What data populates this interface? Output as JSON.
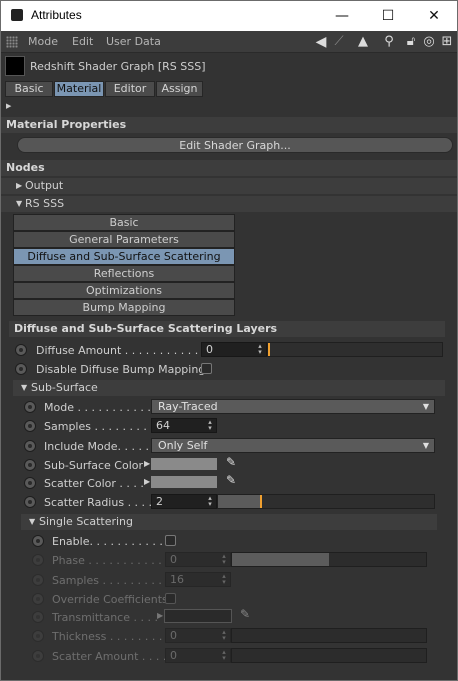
{
  "window": {
    "title": "Attributes",
    "min_label": "—",
    "max_label": "☐",
    "close_label": "✕"
  },
  "menu": {
    "items": [
      "Mode",
      "Edit",
      "User Data"
    ]
  },
  "header": {
    "object_name": "Redshift Shader Graph [RS SSS]"
  },
  "tabs": [
    "Basic",
    "Material",
    "Editor",
    "Assign"
  ],
  "material_properties": {
    "title": "Material Properties",
    "edit_button": "Edit Shader Graph..."
  },
  "nodes": {
    "title": "Nodes",
    "output_label": "Output",
    "rs_sss_label": "RS SSS",
    "pages": [
      "Basic",
      "General Parameters",
      "Diffuse and Sub-Surface Scattering Layers",
      "Reflections",
      "Optimizations",
      "Bump Mapping"
    ]
  },
  "diffuse": {
    "title": "Diffuse and Sub-Surface Scattering Layers",
    "amount_label": "Diffuse Amount . . . . . . . . . . . . .",
    "amount_value": "0",
    "amount_slider": 0.0,
    "disable_bump_label": "Disable Diffuse Bump Mapping"
  },
  "subsurface": {
    "title": "Sub-Surface",
    "mode_label": "Mode . . . . . . . . . . .",
    "mode_value": "Ray-Traced",
    "samples_label": "Samples . . . . . . . . .",
    "samples_value": "64",
    "include_label": "Include Mode. . . . . .",
    "include_value": "Only Self",
    "color_label": "Sub-Surface Color",
    "scatter_color_label": "Scatter Color . . . .",
    "radius_label": "Scatter Radius . . . .",
    "radius_value": "2",
    "radius_slider": 0.2
  },
  "single": {
    "title": "Single Scattering",
    "enable_label": "Enable. . . . . . . . . . .",
    "phase_label": "Phase . . . . . . . . . . .",
    "phase_value": "0",
    "phase_slider": 0.5,
    "samples_label": "Samples . . . . . . . . . .",
    "samples_value": "16",
    "override_label": "Override Coefficients",
    "transmittance_label": "Transmittance . . . .",
    "thickness_label": "Thickness . . . . . . . .",
    "thickness_value": "0",
    "scatter_amount_label": "Scatter Amount . . . .",
    "scatter_amount_value": "0"
  },
  "colors": {
    "accent_tab": "#7b96b3",
    "slider_marker": "#f0a030"
  }
}
